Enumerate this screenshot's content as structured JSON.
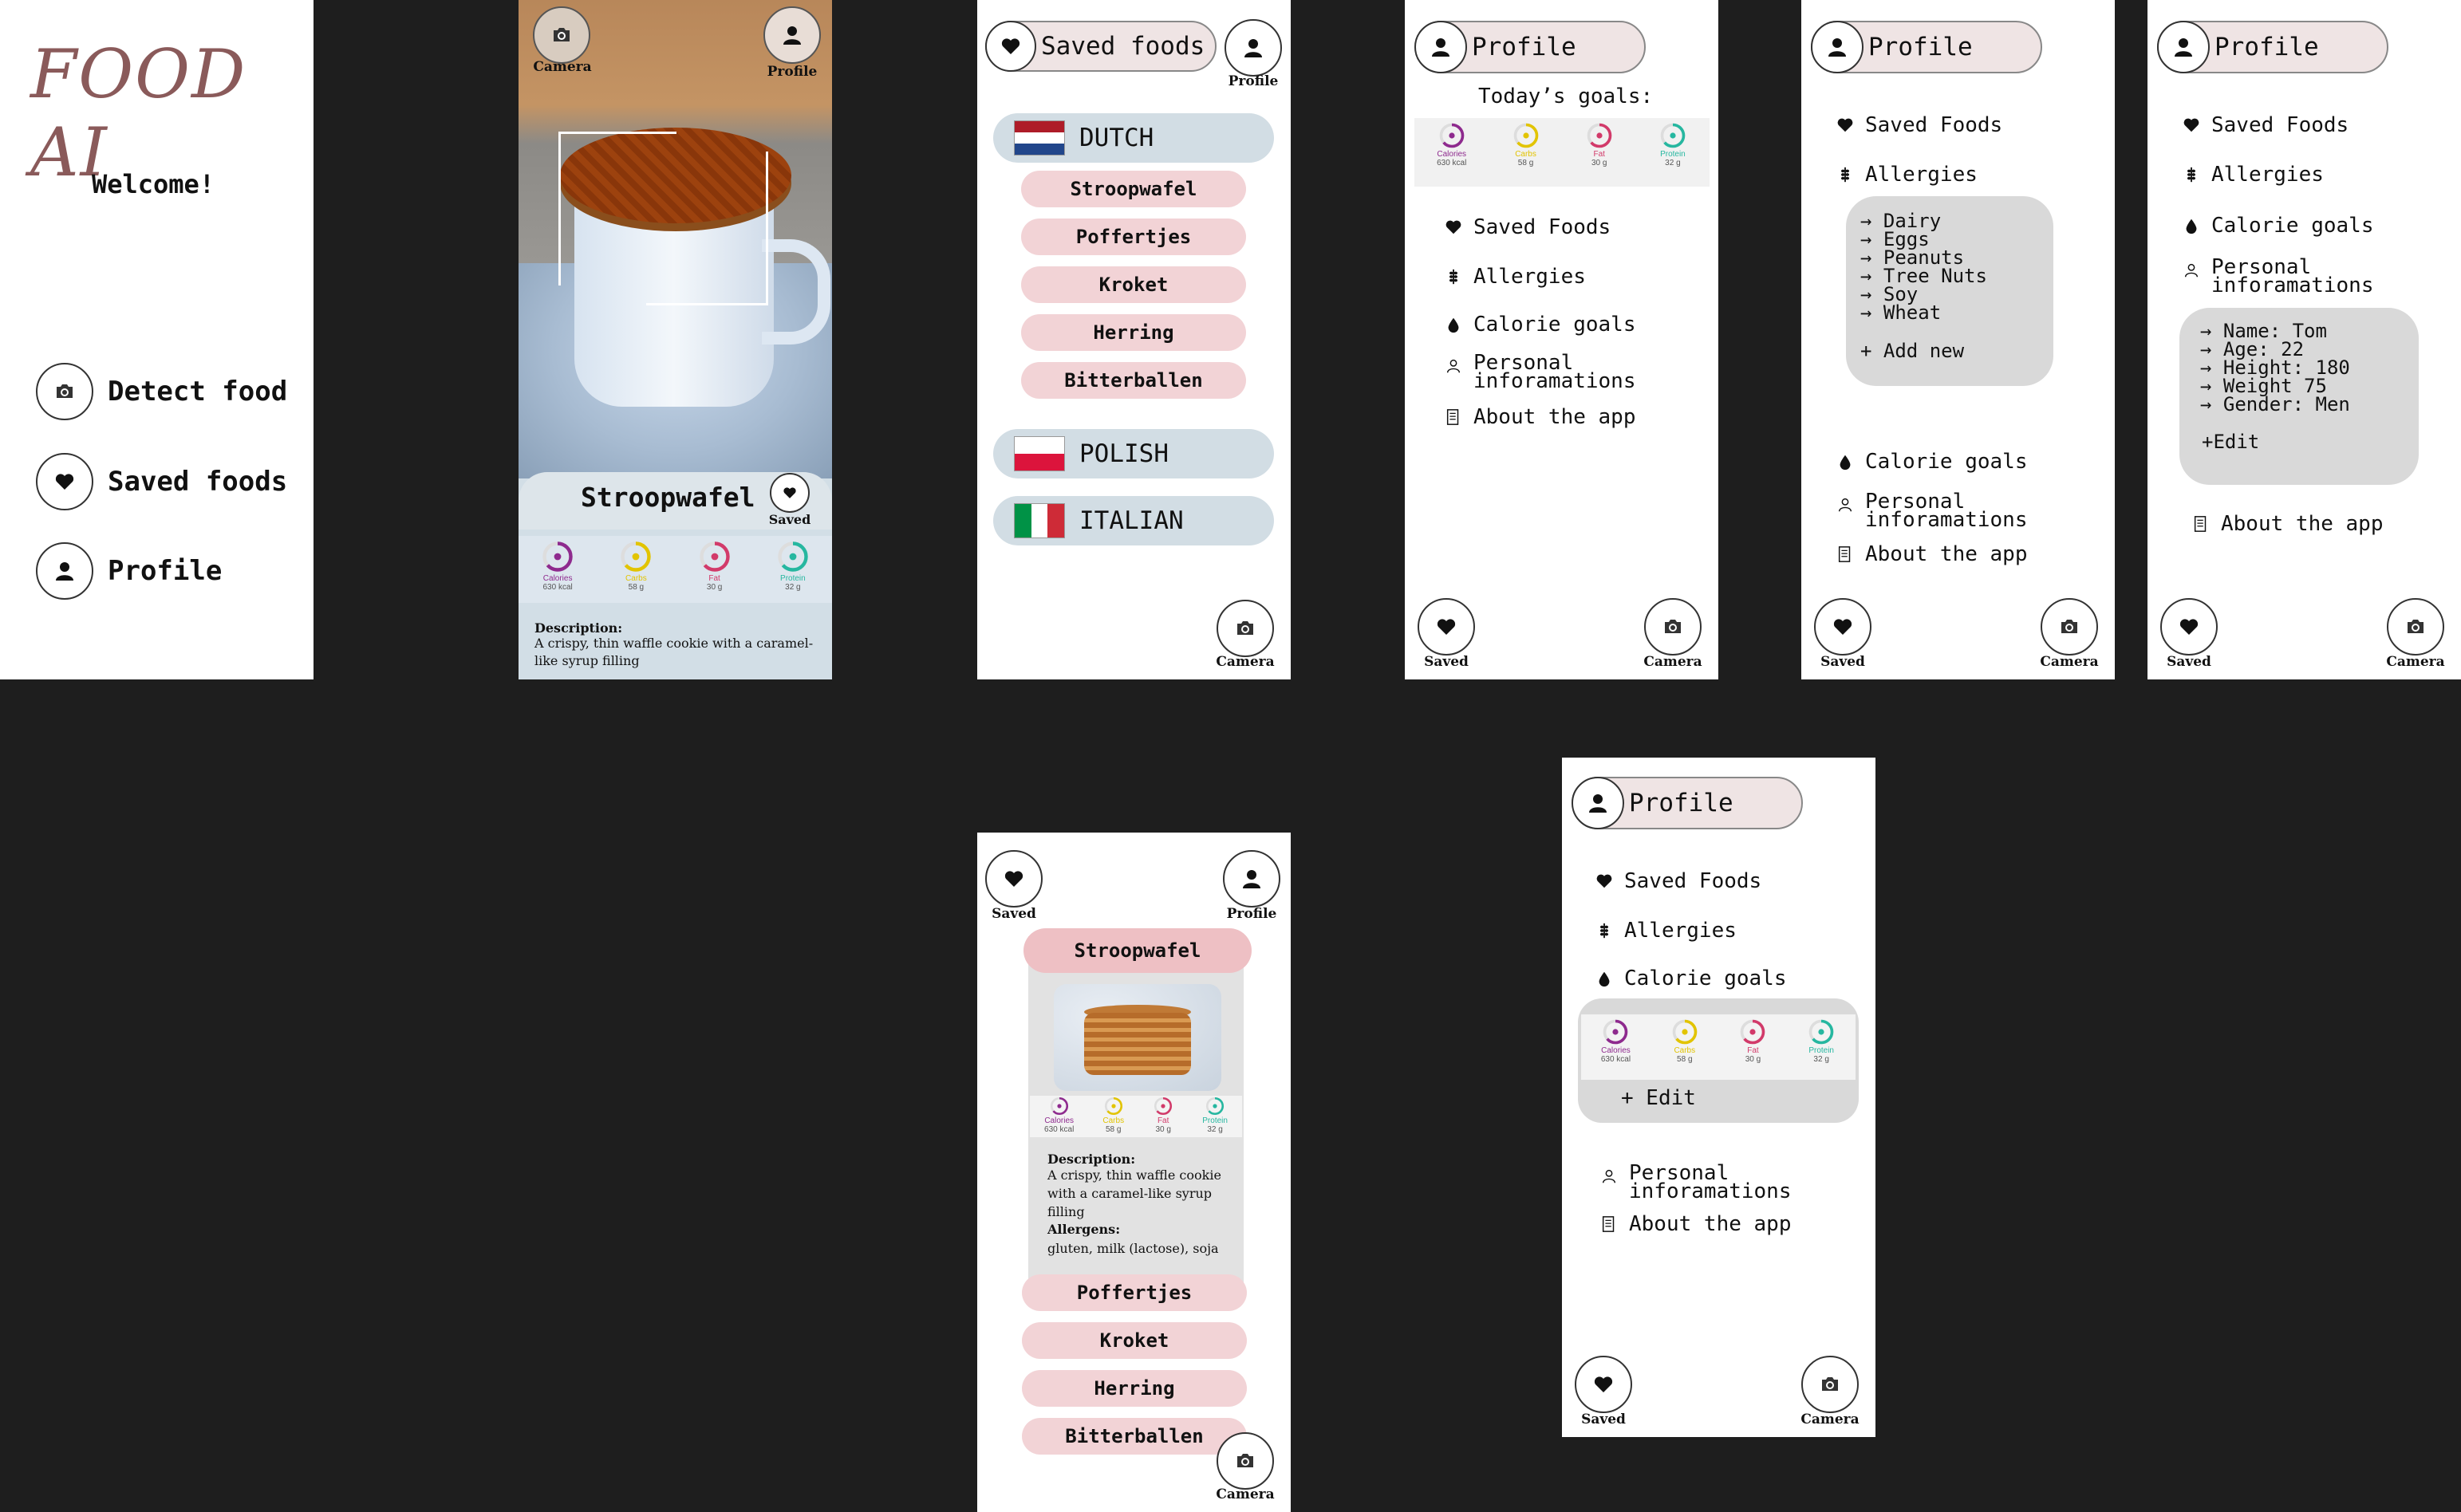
{
  "welcome_screen": {
    "logo": "FOOD AI",
    "welcome": "Welcome!",
    "menu": [
      {
        "icon": "camera-icon",
        "label": "Detect food"
      },
      {
        "icon": "heart-icon",
        "label": "Saved foods"
      },
      {
        "icon": "person-icon",
        "label": "Profile"
      }
    ]
  },
  "camera_screen": {
    "camera_caption": "Camera",
    "profile_caption": "Profile",
    "food_name": "Stroopwafel",
    "saved_caption": "Saved",
    "nutrients": [
      {
        "label": "Calories",
        "value": "630 kcal",
        "color": "#8e2a8e"
      },
      {
        "label": "Carbs",
        "value": "58 g",
        "color": "#e2c400"
      },
      {
        "label": "Fat",
        "value": "30 g",
        "color": "#d23a6a"
      },
      {
        "label": "Protein",
        "value": "32 g",
        "color": "#26b7a0"
      }
    ],
    "description_label": "Description:",
    "description": "A crispy, thin waffle cookie with a caramel-like syrup filling"
  },
  "saved_foods_screen": {
    "header": "Saved foods",
    "profile_caption": "Profile",
    "camera_caption": "Camera",
    "countries": [
      {
        "name": "DUTCH",
        "flag": [
          "#ae1c28",
          "#ffffff",
          "#21468b"
        ]
      },
      {
        "name": "POLISH",
        "flag": [
          "#ffffff",
          "#dc143c"
        ]
      },
      {
        "name": "ITALIAN",
        "flag_vertical": [
          "#009246",
          "#ffffff",
          "#ce2b37"
        ]
      }
    ],
    "dutch_foods": [
      "Stroopwafel",
      "Poffertjes",
      "Kroket",
      "Herring",
      "Bitterballen"
    ]
  },
  "profile_screen_1": {
    "header": "Profile",
    "goals_title": "Today’s goals:",
    "menu": [
      {
        "icon": "heart-icon",
        "label": "Saved Foods"
      },
      {
        "icon": "wheat-icon",
        "label": "Allergies"
      },
      {
        "icon": "drop-icon",
        "label": "Calorie goals"
      },
      {
        "icon": "person-outline-icon",
        "label": "Personal\ninforamations"
      },
      {
        "icon": "document-icon",
        "label": "About the app"
      }
    ],
    "saved_caption": "Saved",
    "camera_caption": "Camera"
  },
  "profile_screen_2": {
    "header": "Profile",
    "saved_foods": "Saved Foods",
    "allergies": "Allergies",
    "allergy_list": [
      "→ Dairy",
      "→ Eggs",
      "→ Peanuts",
      "→ Tree Nuts",
      "→ Soy",
      "→ Wheat"
    ],
    "add_new": "+ Add new",
    "calorie_goals": "Calorie goals",
    "personal": "Personal\ninforamations",
    "about": "About the app",
    "saved_caption": "Saved",
    "camera_caption": "Camera"
  },
  "profile_screen_3": {
    "header": "Profile",
    "saved_foods": "Saved Foods",
    "allergies": "Allergies",
    "calorie_goals": "Calorie goals",
    "personal": "Personal\ninforamations",
    "personal_list": [
      "→ Name: Tom",
      "→ Age: 22",
      "→ Height: 180",
      "→ Weight 75",
      "→ Gender: Men"
    ],
    "edit": "+Edit",
    "about": "About the app",
    "saved_caption": "Saved",
    "camera_caption": "Camera"
  },
  "food_detail_screen": {
    "saved_caption": "Saved",
    "profile_caption": "Profile",
    "camera_caption": "Camera",
    "title": "Stroopwafel",
    "description_label": "Description:",
    "description": "A crispy, thin waffle cookie with a caramel-like syrup filling",
    "allergens_label": "Allergens:",
    "allergens": "gluten, milk (lactose), soja",
    "other_foods": [
      "Poffertjes",
      "Kroket",
      "Herring",
      "Bitterballen"
    ]
  },
  "profile_screen_4": {
    "header": "Profile",
    "saved_foods": "Saved Foods",
    "allergies": "Allergies",
    "calorie_goals": "Calorie goals",
    "edit": "+ Edit",
    "personal": "Personal\ninforamations",
    "about": "About the app",
    "saved_caption": "Saved",
    "camera_caption": "Camera"
  }
}
